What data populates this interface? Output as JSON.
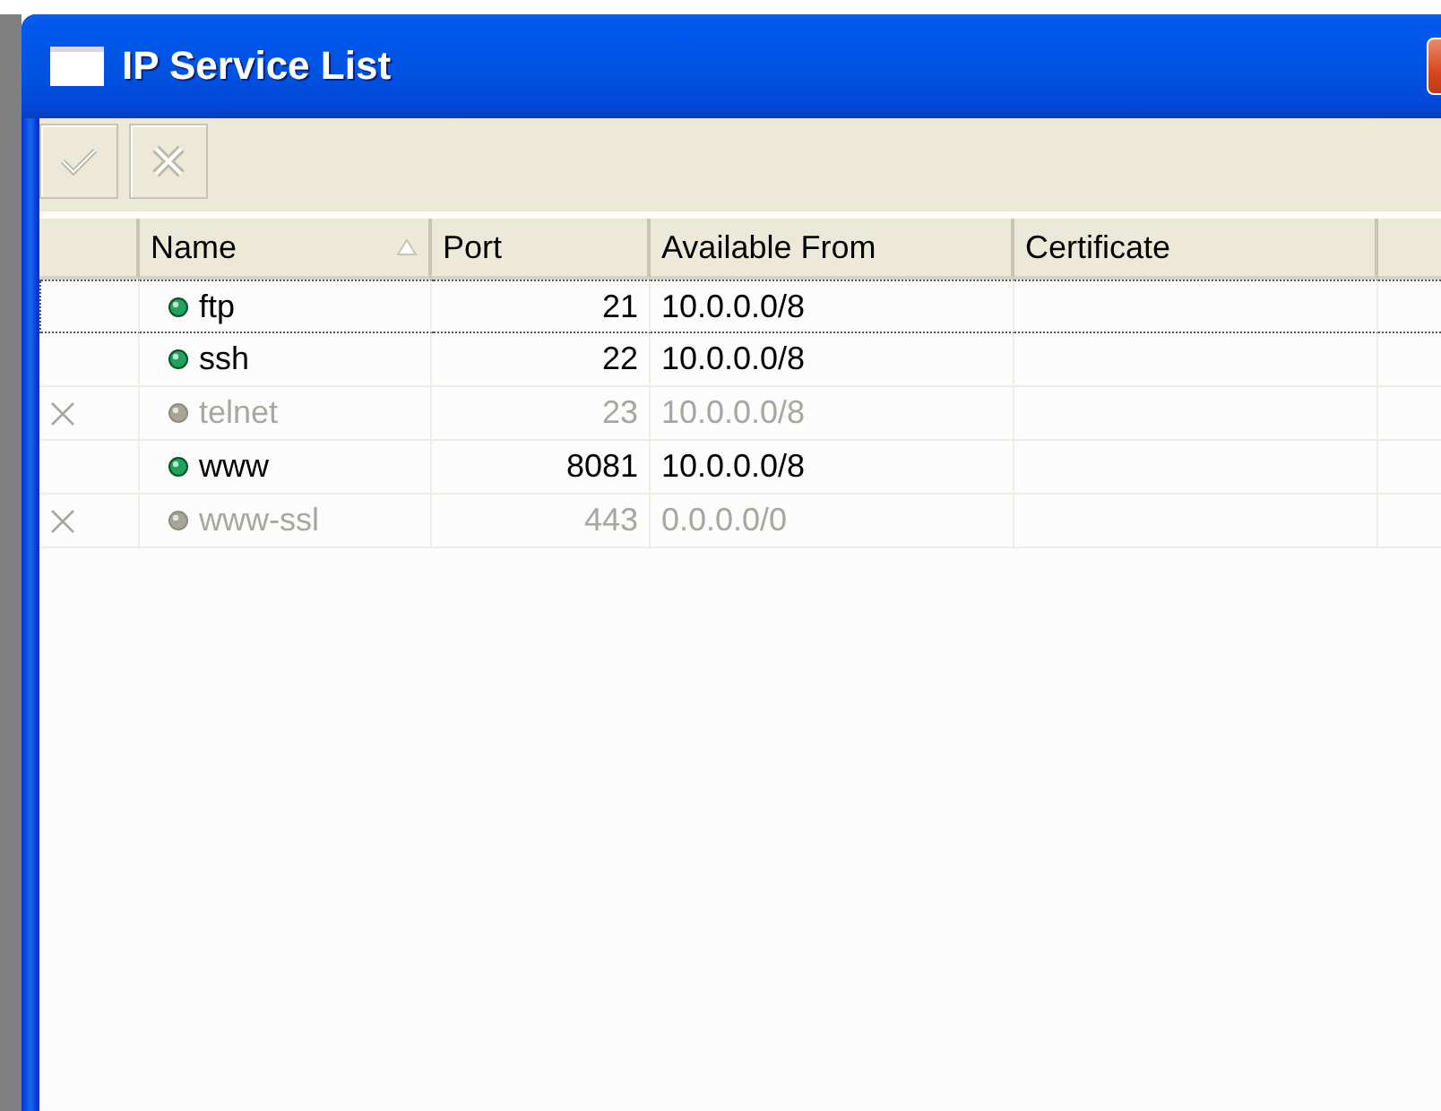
{
  "window": {
    "title": "IP Service List"
  },
  "toolbar": [
    {
      "kind": "enable",
      "disabled": true
    },
    {
      "kind": "disable",
      "disabled": true
    }
  ],
  "table": {
    "columns": [
      {},
      {
        "label": "Name",
        "sorted": true
      },
      {
        "label": "Port"
      },
      {
        "label": "Available From"
      },
      {
        "label": "Certificate"
      },
      {}
    ],
    "rows": [
      {
        "name": "ftp",
        "port": "21",
        "available_from": "10.0.0.0/8",
        "disabled": false,
        "selected": true
      },
      {
        "name": "ssh",
        "port": "22",
        "available_from": "10.0.0.0/8",
        "disabled": false,
        "selected": false
      },
      {
        "name": "telnet",
        "port": "23",
        "available_from": "10.0.0.0/8",
        "disabled": true,
        "selected": false
      },
      {
        "name": "www",
        "port": "8081",
        "available_from": "10.0.0.0/8",
        "disabled": false,
        "selected": false
      },
      {
        "name": "www-ssl",
        "port": "443",
        "available_from": "0.0.0.0/0",
        "disabled": true,
        "selected": false
      }
    ]
  }
}
